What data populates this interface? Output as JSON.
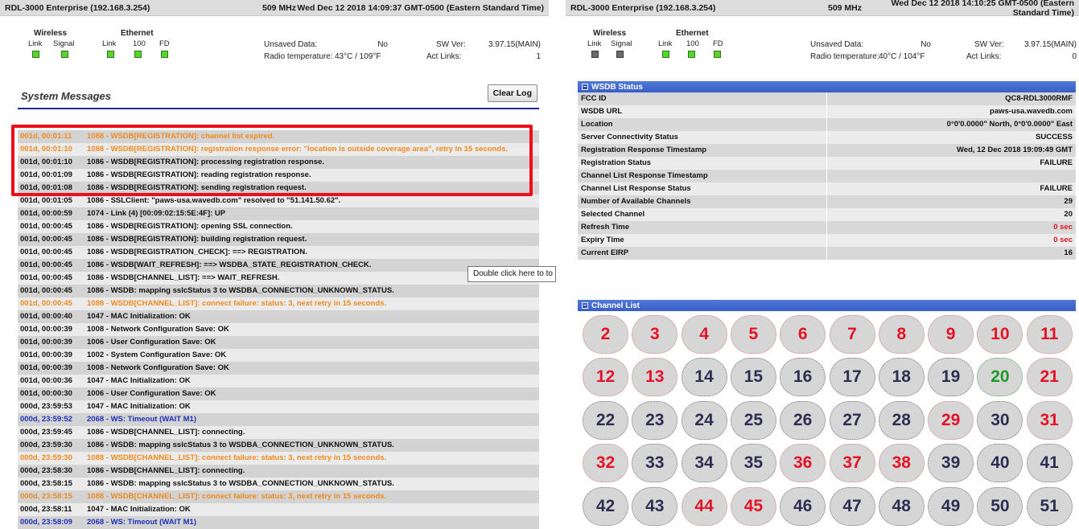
{
  "left": {
    "header": {
      "title": "RDL-3000 Enterprise (192.168.3.254)",
      "freq": "509 MHz",
      "datetime": "Wed Dec 12 2018 14:09:37 GMT-0500 (Eastern Standard Time)"
    },
    "status": {
      "wireless_label": "Wireless",
      "ethernet_label": "Ethernet",
      "link": "Link",
      "signal": "Signal",
      "eth_link": "Link",
      "eth_100": "100",
      "eth_fd": "FD",
      "unsaved_label": "Unsaved Data:",
      "unsaved_value": "No",
      "temp_label": "Radio temperature:",
      "temp_value": "43°C / 109°F",
      "swver_label": "SW Ver:",
      "swver_value": "3.97.15(MAIN)",
      "actlinks_label": "Act Links:",
      "actlinks_value": "1"
    },
    "system_messages": {
      "title": "System Messages",
      "clear_button": "Clear Log"
    },
    "tooltip": "Double click here to to",
    "log": [
      {
        "time": "001d,  00:01:11",
        "msg": "1088 - WSDB[REGISTRATION]: channel list expired.",
        "color": "orange"
      },
      {
        "time": "001d,  00:01:10",
        "msg": "1088 - WSDB[REGISTRATION]: registration response error: \"location is outside coverage area\", retry in 15 seconds.",
        "color": "orange"
      },
      {
        "time": "001d,  00:01:10",
        "msg": "1086 - WSDB[REGISTRATION]: processing registration response.",
        "color": "default"
      },
      {
        "time": "001d,  00:01:09",
        "msg": "1086 - WSDB[REGISTRATION]: reading registration response.",
        "color": "default"
      },
      {
        "time": "001d,  00:01:08",
        "msg": "1086 - WSDB[REGISTRATION]: sending registration request.",
        "color": "default"
      },
      {
        "time": "001d,  00:01:05",
        "msg": "1086 - SSLClient: \"paws-usa.wavedb.com\" resolved to \"51.141.50.62\".",
        "color": "default"
      },
      {
        "time": "001d,  00:00:59",
        "msg": "1074 - Link (4) [00:09:02:15:5E:4F]: UP",
        "color": "default"
      },
      {
        "time": "001d,  00:00:45",
        "msg": "1086 - WSDB[REGISTRATION]: opening SSL connection.",
        "color": "default"
      },
      {
        "time": "001d,  00:00:45",
        "msg": "1086 - WSDB[REGISTRATION]: building registration request.",
        "color": "default"
      },
      {
        "time": "001d,  00:00:45",
        "msg": "1086 - WSDB[REGISTRATION_CHECK]: ==> REGISTRATION.",
        "color": "default"
      },
      {
        "time": "001d,  00:00:45",
        "msg": "1086 - WSDB[WAIT_REFRESH]: ==> WSDBA_STATE_REGISTRATION_CHECK.",
        "color": "default"
      },
      {
        "time": "001d,  00:00:45",
        "msg": "1086 - WSDB[CHANNEL_LIST]: ==> WAIT_REFRESH.",
        "color": "default"
      },
      {
        "time": "001d,  00:00:45",
        "msg": "1086 - WSDB: mapping sslcStatus 3 to WSDBA_CONNECTION_UNKNOWN_STATUS.",
        "color": "default"
      },
      {
        "time": "001d,  00:00:45",
        "msg": "1088 - WSDB[CHANNEL_LIST]: connect failure: status: 3, next retry in 15 seconds.",
        "color": "orange"
      },
      {
        "time": "001d,  00:00:40",
        "msg": "1047 - MAC Initialization: OK",
        "color": "default"
      },
      {
        "time": "001d,  00:00:39",
        "msg": "1008 - Network Configuration Save: OK",
        "color": "default"
      },
      {
        "time": "001d,  00:00:39",
        "msg": "1006 - User Configuration Save: OK",
        "color": "default"
      },
      {
        "time": "001d,  00:00:39",
        "msg": "1002 - System Configuration Save: OK",
        "color": "default"
      },
      {
        "time": "001d,  00:00:39",
        "msg": "1008 - Network Configuration Save: OK",
        "color": "default"
      },
      {
        "time": "001d,  00:00:36",
        "msg": "1047 - MAC Initialization: OK",
        "color": "default"
      },
      {
        "time": "001d,  00:00:30",
        "msg": "1006 - User Configuration Save: OK",
        "color": "default"
      },
      {
        "time": "000d,  23:59:53",
        "msg": "1047 - MAC Initialization: OK",
        "color": "default"
      },
      {
        "time": "000d,  23:59:52",
        "msg": "2068 - WS: Timeout (WAIT M1)",
        "color": "blue"
      },
      {
        "time": "000d,  23:59:45",
        "msg": "1086 - WSDB[CHANNEL_LIST]: connecting.",
        "color": "default"
      },
      {
        "time": "000d,  23:59:30",
        "msg": "1086 - WSDB: mapping sslcStatus 3 to WSDBA_CONNECTION_UNKNOWN_STATUS.",
        "color": "default"
      },
      {
        "time": "000d,  23:59:30",
        "msg": "1088 - WSDB[CHANNEL_LIST]: connect failure: status: 3, next retry in 15 seconds.",
        "color": "orange"
      },
      {
        "time": "000d,  23:58:30",
        "msg": "1086 - WSDB[CHANNEL_LIST]: connecting.",
        "color": "default"
      },
      {
        "time": "000d,  23:58:15",
        "msg": "1086 - WSDB: mapping sslcStatus 3 to WSDBA_CONNECTION_UNKNOWN_STATUS.",
        "color": "default"
      },
      {
        "time": "000d,  23:58:15",
        "msg": "1088 - WSDB[CHANNEL_LIST]: connect failure: status: 3, next retry in 15 seconds.",
        "color": "orange"
      },
      {
        "time": "000d,  23:58:11",
        "msg": "1047 - MAC Initialization: OK",
        "color": "default"
      },
      {
        "time": "000d,  23:58:09",
        "msg": "2068 - WS: Timeout (WAIT M1)",
        "color": "blue"
      }
    ]
  },
  "right": {
    "header": {
      "title": "RDL-3000 Enterprise (192.168.3.254)",
      "freq": "509 MHz",
      "datetime": "Wed Dec 12 2018 14:10:25 GMT-0500 (Eastern Standard Time)"
    },
    "status": {
      "wireless_label": "Wireless",
      "ethernet_label": "Ethernet",
      "link": "Link",
      "signal": "Signal",
      "eth_link": "Link",
      "eth_100": "100",
      "eth_fd": "FD",
      "unsaved_label": "Unsaved Data:",
      "unsaved_value": "No",
      "temp_label": "Radio temperature:",
      "temp_value": "40°C / 104°F",
      "swver_label": "SW Ver:",
      "swver_value": "3.97.15(MAIN)",
      "actlinks_label": "Act Links:",
      "actlinks_value": "0"
    },
    "wsdb": {
      "title": "WSDB Status",
      "rows": [
        {
          "key": "FCC ID",
          "value": "QC8-RDL3000RMF",
          "red": false
        },
        {
          "key": "WSDB URL",
          "value": "paws-usa.wavedb.com",
          "red": false
        },
        {
          "key": "Location",
          "value": "0°0'0.0000\" North, 0°0'0.0000\" East",
          "red": false
        },
        {
          "key": "Server Connectivity Status",
          "value": "SUCCESS",
          "red": false
        },
        {
          "key": "Registration Response Timestamp",
          "value": "Wed, 12 Dec 2018 19:09:49 GMT",
          "red": false
        },
        {
          "key": "Registration Status",
          "value": "FAILURE",
          "red": false
        },
        {
          "key": "Channel List Response Timestamp",
          "value": "",
          "red": false
        },
        {
          "key": "Channel List Response Status",
          "value": "FAILURE",
          "red": false
        },
        {
          "key": "Number of Available Channels",
          "value": "29",
          "red": false
        },
        {
          "key": "Selected Channel",
          "value": "20",
          "red": false
        },
        {
          "key": "Refresh Time",
          "value": "0 sec",
          "red": true
        },
        {
          "key": "Expiry Time",
          "value": "0 sec",
          "red": true
        },
        {
          "key": "Current EIRP",
          "value": "16",
          "red": false
        }
      ]
    },
    "channel_list": {
      "title": "Channel List",
      "channels": [
        {
          "n": "2",
          "s": "red"
        },
        {
          "n": "3",
          "s": "red"
        },
        {
          "n": "4",
          "s": "red"
        },
        {
          "n": "5",
          "s": "red"
        },
        {
          "n": "6",
          "s": "red"
        },
        {
          "n": "7",
          "s": "red"
        },
        {
          "n": "8",
          "s": "red"
        },
        {
          "n": "9",
          "s": "red"
        },
        {
          "n": "10",
          "s": "red"
        },
        {
          "n": "11",
          "s": "red"
        },
        {
          "n": "12",
          "s": "red"
        },
        {
          "n": "13",
          "s": "red"
        },
        {
          "n": "14",
          "s": "dark"
        },
        {
          "n": "15",
          "s": "dark"
        },
        {
          "n": "16",
          "s": "dark"
        },
        {
          "n": "17",
          "s": "dark"
        },
        {
          "n": "18",
          "s": "dark"
        },
        {
          "n": "19",
          "s": "dark"
        },
        {
          "n": "20",
          "s": "green"
        },
        {
          "n": "21",
          "s": "red"
        },
        {
          "n": "22",
          "s": "dark"
        },
        {
          "n": "23",
          "s": "dark"
        },
        {
          "n": "24",
          "s": "dark"
        },
        {
          "n": "25",
          "s": "dark"
        },
        {
          "n": "26",
          "s": "dark"
        },
        {
          "n": "27",
          "s": "dark"
        },
        {
          "n": "28",
          "s": "dark"
        },
        {
          "n": "29",
          "s": "red"
        },
        {
          "n": "30",
          "s": "dark"
        },
        {
          "n": "31",
          "s": "red"
        },
        {
          "n": "32",
          "s": "red"
        },
        {
          "n": "33",
          "s": "dark"
        },
        {
          "n": "34",
          "s": "dark"
        },
        {
          "n": "35",
          "s": "dark"
        },
        {
          "n": "36",
          "s": "red"
        },
        {
          "n": "37",
          "s": "red"
        },
        {
          "n": "38",
          "s": "red"
        },
        {
          "n": "39",
          "s": "dark"
        },
        {
          "n": "40",
          "s": "dark"
        },
        {
          "n": "41",
          "s": "dark"
        },
        {
          "n": "42",
          "s": "dark"
        },
        {
          "n": "43",
          "s": "dark"
        },
        {
          "n": "44",
          "s": "red"
        },
        {
          "n": "45",
          "s": "red"
        },
        {
          "n": "46",
          "s": "dark"
        },
        {
          "n": "47",
          "s": "dark"
        },
        {
          "n": "48",
          "s": "dark"
        },
        {
          "n": "49",
          "s": "dark"
        },
        {
          "n": "50",
          "s": "dark"
        },
        {
          "n": "51",
          "s": "dark"
        }
      ]
    }
  }
}
